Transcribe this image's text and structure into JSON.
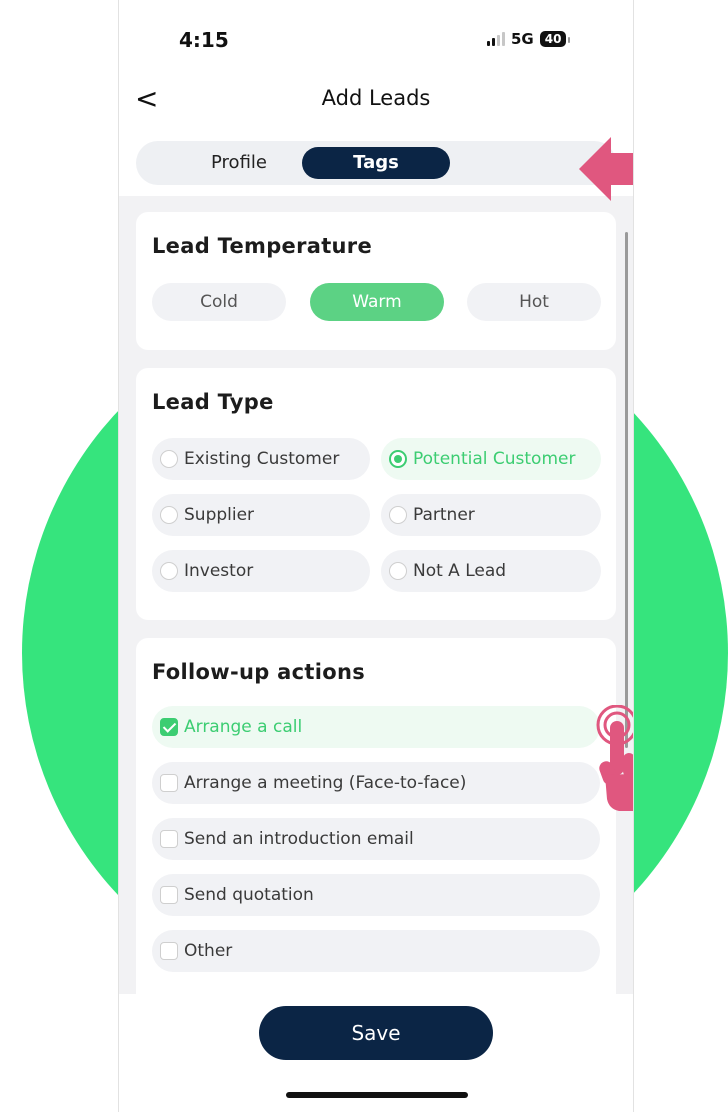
{
  "status_bar": {
    "time": "4:15",
    "network": "5G",
    "battery": "40"
  },
  "nav": {
    "back_icon": "chevron-left-icon",
    "back_glyph": "<",
    "title": "Add Leads"
  },
  "tabs": [
    {
      "label": "Profile",
      "active": false
    },
    {
      "label": "Tags",
      "active": true
    }
  ],
  "lead_temperature": {
    "title": "Lead Temperature",
    "options": [
      "Cold",
      "Warm",
      "Hot"
    ],
    "selected": "Warm"
  },
  "lead_type": {
    "title": "Lead Type",
    "options": [
      "Existing Customer",
      "Potential Customer",
      "Supplier",
      "Partner",
      "Investor",
      "Not A Lead"
    ],
    "selected": "Potential Customer"
  },
  "follow_up": {
    "title": "Follow-up actions",
    "items": [
      {
        "label": "Arrange a call",
        "checked": true
      },
      {
        "label": "Arrange a meeting (Face-to-face)",
        "checked": false
      },
      {
        "label": "Send an introduction email",
        "checked": false
      },
      {
        "label": "Send quotation",
        "checked": false
      },
      {
        "label": "Other",
        "checked": false
      }
    ]
  },
  "save_button": {
    "label": "Save"
  },
  "colors": {
    "primary": "#0b2545",
    "accent_green": "#3ccd72",
    "warm_green": "#5cd284",
    "background_circle": "#36e47d",
    "annotation_pink": "#e0577f"
  },
  "annotations": {
    "arrow_icon": "arrow-left-icon",
    "tap_icon": "tap-hand-icon"
  }
}
